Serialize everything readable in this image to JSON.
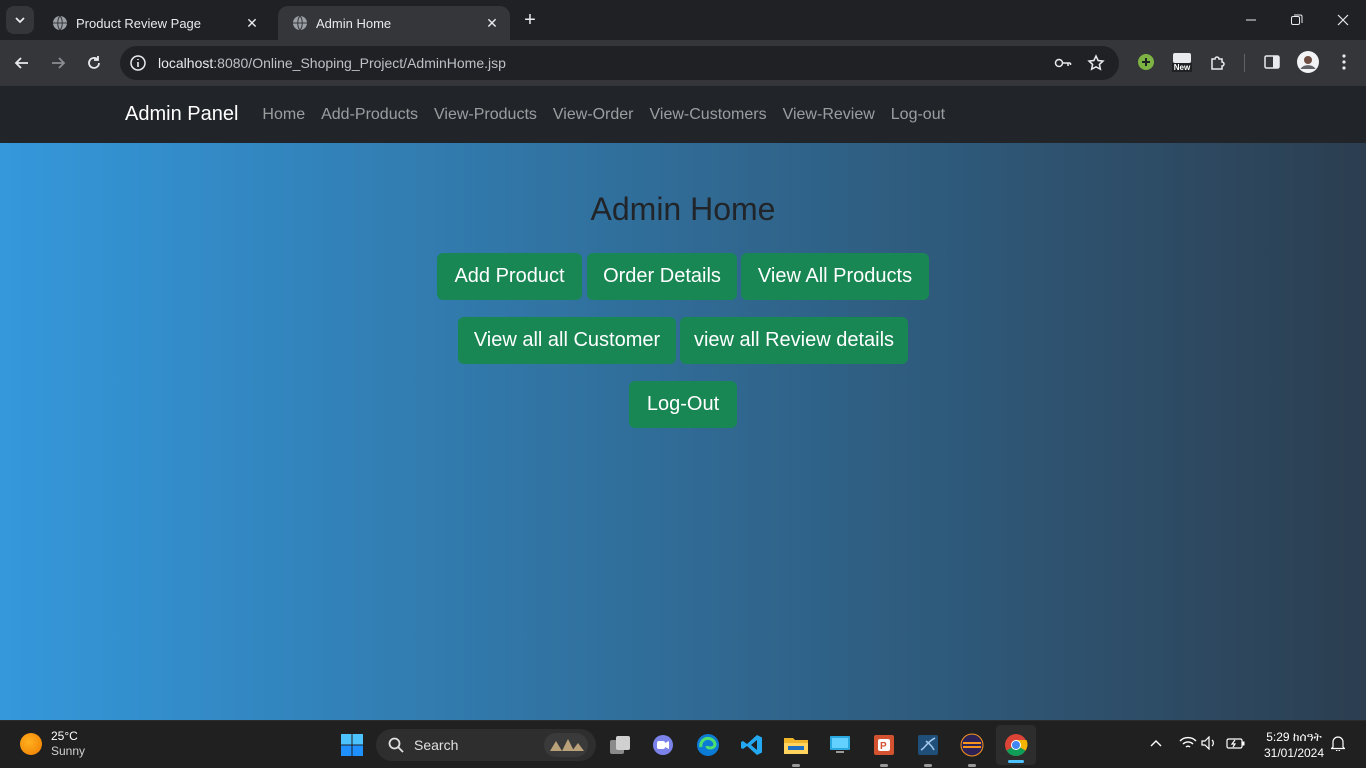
{
  "browser": {
    "tabs": [
      {
        "title": "Product Review Page",
        "active": false
      },
      {
        "title": "Admin Home",
        "active": true
      }
    ],
    "url_host": "localhost",
    "url_rest": ":8080/Online_Shoping_Project/AdminHome.jsp",
    "extension_badge": "New",
    "icons": [
      "tab-search-icon",
      "globe-icon",
      "close-icon",
      "new-tab-icon",
      "minimize-icon",
      "restore-icon",
      "window-close-icon",
      "back-icon",
      "forward-icon",
      "reload-icon",
      "site-info-icon",
      "key-icon",
      "star-icon",
      "extension-plus-icon",
      "extensions-puzzle-icon",
      "side-panel-icon",
      "profile-avatar",
      "menu-kebab-icon"
    ]
  },
  "navbar": {
    "brand": "Admin Panel",
    "links": [
      "Home",
      "Add-Products",
      "View-Products",
      "View-Order",
      "View-Customers",
      "View-Review",
      "Log-out"
    ]
  },
  "main": {
    "title": "Admin Home",
    "buttons": [
      "Add Product",
      "Order Details",
      "View All Products",
      "View all all Customer",
      "view all Review details",
      "Log-Out"
    ],
    "colors": {
      "gradient_start": "#3498db",
      "gradient_end": "#2c3e50",
      "button": "#198754",
      "navbar": "#212529"
    }
  },
  "taskbar": {
    "weather_temp": "25°C",
    "weather_desc": "Sunny",
    "search_label": "Search",
    "clock_time": "5:29 ከሰዓት",
    "clock_date": "31/01/2024",
    "apps": [
      "windows-start-icon",
      "search-icon",
      "task-view-icon",
      "chat-icon",
      "edge-icon",
      "vscode-icon",
      "file-explorer-icon",
      "remote-desktop-icon",
      "powerpoint-icon",
      "mysql-workbench-icon",
      "eclipse-icon",
      "chrome-icon"
    ],
    "tray": [
      "chevron-up-icon",
      "wifi-icon",
      "volume-icon",
      "battery-icon",
      "notification-bell-icon"
    ]
  }
}
